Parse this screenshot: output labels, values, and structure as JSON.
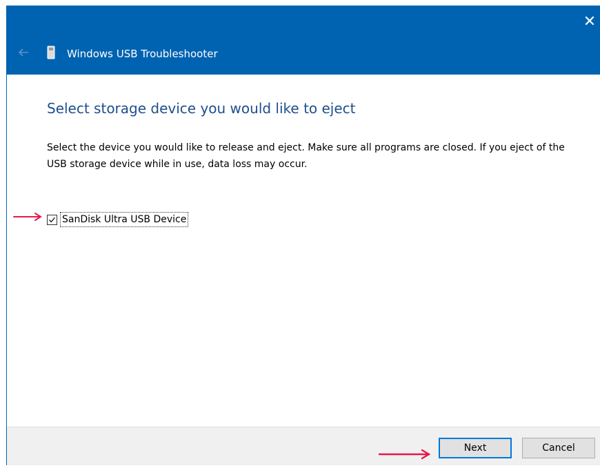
{
  "window": {
    "title": "Windows USB Troubleshooter",
    "close_glyph": "✕",
    "accent_color": "#0063b1"
  },
  "main": {
    "heading": "Select storage device you would like to eject",
    "description": "Select the device you would like to release and eject. Make sure all programs are closed. If you eject of the USB storage device while in use, data loss may occur.",
    "devices": [
      {
        "label": "SanDisk Ultra USB Device",
        "checked": true
      }
    ]
  },
  "footer": {
    "next_label": "Next",
    "cancel_label": "Cancel"
  },
  "annotations": {
    "arrow_color": "#e8174b"
  }
}
